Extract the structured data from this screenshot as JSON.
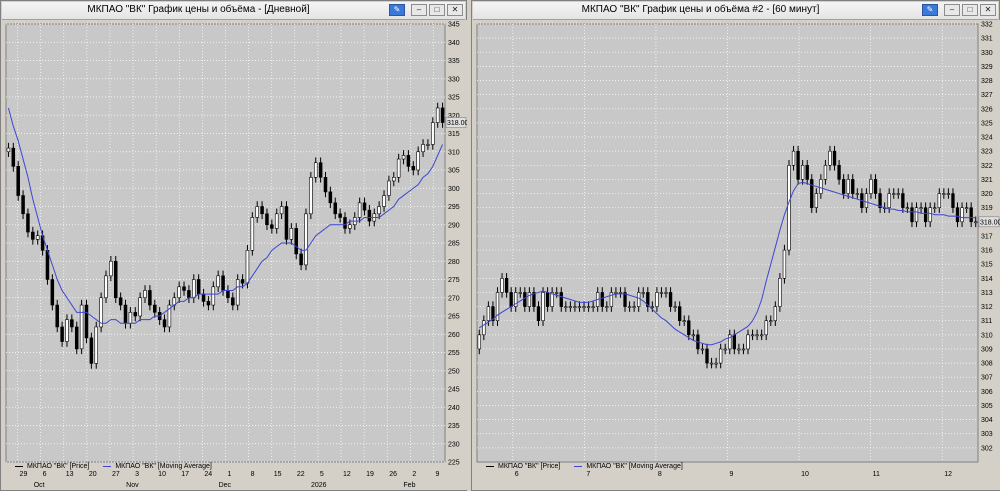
{
  "windows": [
    {
      "title": "МКПАО \"ВК\" График цены и объёма - [Дневной]"
    },
    {
      "title": "МКПАО \"ВК\" График цены и объёма #2 - [60 минут]"
    }
  ],
  "legend": {
    "price": "МКПАО \"ВК\" [Price]",
    "ma": "МКПАО \"ВК\" [Moving Average]"
  },
  "colors": {
    "ma_line": "#3c46d2",
    "price_tag": "#e0e0e0",
    "grid": "#ffffff",
    "bg": "#c8c8c8"
  },
  "chart_data": [
    {
      "type": "candlestick",
      "interval": "Дневной",
      "ylim": [
        225,
        345
      ],
      "yticks": [
        225,
        230,
        235,
        240,
        245,
        250,
        255,
        260,
        265,
        270,
        275,
        280,
        285,
        290,
        295,
        300,
        305,
        310,
        315,
        320,
        325,
        330,
        335,
        340,
        345
      ],
      "last_price_label": "318.00",
      "last_price": 318.0,
      "xticks": [
        "29",
        "6",
        "13",
        "20",
        "27",
        "3",
        "10",
        "17",
        "24",
        "1",
        "8",
        "15",
        "22",
        "5",
        "12",
        "19",
        "26",
        "2",
        "9"
      ],
      "xtick_months": [
        "Oct",
        "Nov",
        "Dec",
        "2026",
        "Feb"
      ],
      "close": [
        311,
        306,
        298,
        293,
        288,
        286,
        287,
        283,
        275,
        268,
        262,
        258,
        264,
        262,
        256,
        268,
        259,
        252,
        262,
        270,
        276,
        280,
        270,
        268,
        263,
        266,
        265,
        270,
        272,
        268,
        266,
        264,
        262,
        268,
        270,
        273,
        272,
        270,
        275,
        271,
        269,
        268,
        273,
        276,
        272,
        270,
        268,
        275,
        274,
        283,
        292,
        295,
        293,
        290,
        289,
        293,
        295,
        286,
        289,
        282,
        279,
        293,
        303,
        307,
        303,
        299,
        296,
        293,
        292,
        289,
        290,
        292,
        296,
        294,
        291,
        293,
        295,
        298,
        302,
        303,
        308,
        309,
        306,
        305,
        310,
        312,
        312,
        318,
        322,
        318
      ],
      "ma": [
        322,
        317,
        313,
        308,
        303,
        297,
        292,
        287,
        283,
        279,
        275,
        272,
        270,
        268,
        266,
        266,
        266,
        265,
        264,
        263,
        263,
        264,
        264,
        263,
        263,
        263,
        263,
        264,
        264,
        264,
        265,
        265,
        266,
        267,
        268,
        269,
        269,
        270,
        270,
        271,
        271,
        271,
        271,
        271,
        272,
        272,
        272,
        273,
        273,
        274,
        276,
        278,
        280,
        281,
        283,
        284,
        285,
        285,
        285,
        284,
        283,
        283,
        285,
        287,
        288,
        289,
        290,
        290,
        290,
        290,
        291,
        291,
        291,
        292,
        292,
        292,
        292,
        293,
        294,
        295,
        297,
        298,
        299,
        300,
        301,
        303,
        304,
        306,
        309,
        312
      ]
    },
    {
      "type": "candlestick",
      "interval": "60 минут",
      "ylim": [
        301,
        332
      ],
      "yticks": [
        302,
        303,
        304,
        305,
        306,
        307,
        308,
        309,
        310,
        311,
        312,
        313,
        314,
        315,
        316,
        317,
        318,
        319,
        320,
        321,
        322,
        323,
        324,
        325,
        326,
        327,
        328,
        329,
        330,
        331,
        332
      ],
      "last_price_label": "318.00",
      "last_price": 318.0,
      "xticks": [
        "6",
        "7",
        "8",
        "9",
        "10",
        "11",
        "12"
      ],
      "close": [
        310,
        311,
        312,
        311,
        313,
        314,
        313,
        312,
        313,
        313,
        312,
        313,
        312,
        311,
        313,
        312,
        313,
        313,
        312,
        312,
        312,
        312,
        312,
        312,
        312,
        312,
        313,
        312,
        312,
        313,
        313,
        313,
        312,
        312,
        312,
        313,
        313,
        312,
        312,
        313,
        313,
        313,
        312,
        312,
        311,
        311,
        310,
        310,
        309,
        309,
        308,
        308,
        308,
        309,
        309,
        310,
        309,
        309,
        309,
        310,
        310,
        310,
        310,
        311,
        311,
        312,
        314,
        316,
        322,
        323,
        321,
        322,
        321,
        319,
        320,
        321,
        322,
        323,
        322,
        321,
        320,
        321,
        320,
        320,
        319,
        320,
        321,
        320,
        319,
        319,
        320,
        320,
        320,
        319,
        319,
        318,
        319,
        319,
        318,
        319,
        319,
        320,
        320,
        320,
        319,
        318,
        319,
        319,
        318,
        318
      ],
      "ma": [
        310.5,
        310.7,
        310.9,
        311.1,
        311.4,
        311.6,
        311.8,
        312.0,
        312.2,
        312.4,
        312.6,
        312.8,
        312.9,
        313.0,
        313.1,
        313.0,
        312.9,
        312.8,
        312.7,
        312.6,
        312.5,
        312.4,
        312.3,
        312.3,
        312.3,
        312.4,
        312.5,
        312.6,
        312.7,
        312.8,
        312.9,
        312.9,
        312.9,
        312.8,
        312.7,
        312.6,
        312.4,
        312.1,
        311.8,
        311.5,
        311.2,
        311.0,
        310.7,
        310.4,
        310.2,
        310.0,
        309.8,
        309.6,
        309.5,
        309.4,
        309.3,
        309.3,
        309.4,
        309.5,
        309.7,
        309.8,
        310.0,
        310.2,
        310.4,
        310.6,
        311.0,
        311.6,
        312.5,
        313.8,
        315.0,
        316.2,
        317.4,
        318.5,
        319.4,
        320.2,
        320.7,
        320.8,
        320.7,
        320.6,
        320.5,
        320.4,
        320.3,
        320.2,
        320.1,
        320.0,
        319.9,
        319.8,
        319.7,
        319.6,
        319.5,
        319.4,
        319.3,
        319.2,
        319.1,
        319.0,
        318.9,
        318.9,
        318.8,
        318.8,
        318.7,
        318.7,
        318.7,
        318.6,
        318.6,
        318.6,
        318.5,
        318.5,
        318.5,
        318.4,
        318.4,
        318.4,
        318.3,
        318.3,
        318.3,
        318.3
      ]
    }
  ]
}
